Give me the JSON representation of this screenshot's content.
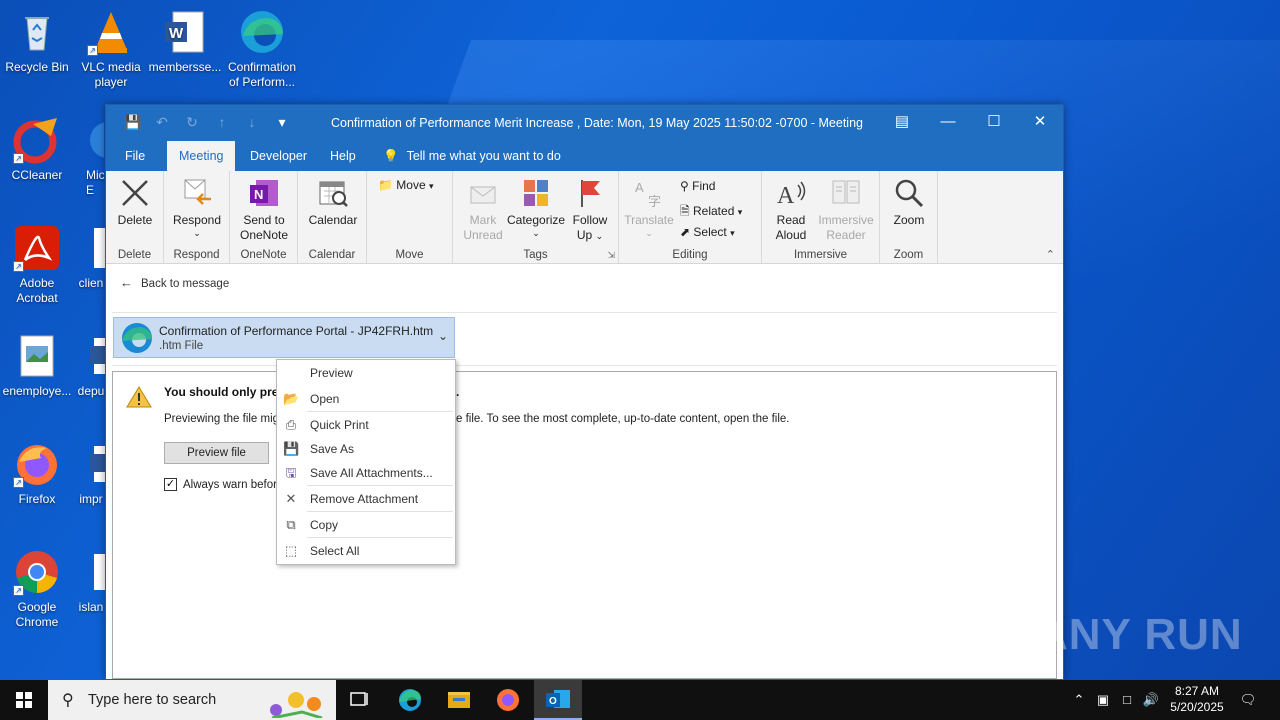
{
  "desktop": {
    "icons": [
      {
        "label": "Recycle Bin"
      },
      {
        "label": "VLC media player"
      },
      {
        "label": "membersse..."
      },
      {
        "label": "Confirmation of Perform..."
      },
      {
        "label": "CCleaner"
      },
      {
        "label": "Mic E"
      },
      {
        "label": "Adobe Acrobat"
      },
      {
        "label": "clien"
      },
      {
        "label": "enemploye..."
      },
      {
        "label": "depu"
      },
      {
        "label": "Firefox"
      },
      {
        "label": "impr"
      },
      {
        "label": "Google Chrome"
      },
      {
        "label": "islan"
      }
    ],
    "watermark": "ANY RUN"
  },
  "window": {
    "title": "Confirmation of Performance Merit Increase , Date: Mon, 19 May 2025 11:50:02 -0700  -  Meeting",
    "tabs": [
      "File",
      "Meeting",
      "Developer",
      "Help"
    ],
    "tell_me": "Tell me what you want to do",
    "ribbon": {
      "delete": {
        "button": "Delete",
        "group": "Delete"
      },
      "respond": {
        "button": "Respond",
        "group": "Respond"
      },
      "onenote": {
        "button_line1": "Send to",
        "button_line2": "OneNote",
        "group": "OneNote"
      },
      "calendar": {
        "button": "Calendar",
        "group": "Calendar"
      },
      "move": {
        "button": "Move",
        "group": "Move"
      },
      "tags": {
        "mark_line1": "Mark",
        "mark_line2": "Unread",
        "categorize": "Categorize",
        "follow_line1": "Follow",
        "follow_line2": "Up",
        "group": "Tags"
      },
      "editing": {
        "translate": "Translate",
        "find": "Find",
        "related": "Related",
        "select": "Select",
        "group": "Editing"
      },
      "immersive": {
        "read_line1": "Read",
        "read_line2": "Aloud",
        "reader_line1": "Immersive",
        "reader_line2": "Reader",
        "group": "Immersive"
      },
      "zoom": {
        "button": "Zoom",
        "group": "Zoom"
      }
    },
    "back_link": "Back to message",
    "attachment": {
      "name": "Confirmation of Performance Portal - JP42FRH.htm",
      "type": ".htm File"
    },
    "warning": {
      "title_visible": "You should only prev",
      "title_tail": ".",
      "text_visible": "Previewing the file mig",
      "text_tail": "e file. To see the most complete, up-to-date content, open the file.",
      "preview_button": "Preview file",
      "always_warn": "Always warn befor"
    }
  },
  "context_menu": {
    "items": [
      "Preview",
      "Open",
      "Quick Print",
      "Save As",
      "Save All Attachments...",
      "Remove Attachment",
      "Copy",
      "Select All"
    ]
  },
  "taskbar": {
    "search_placeholder": "Type here to search",
    "time": "8:27 AM",
    "date": "5/20/2025"
  }
}
